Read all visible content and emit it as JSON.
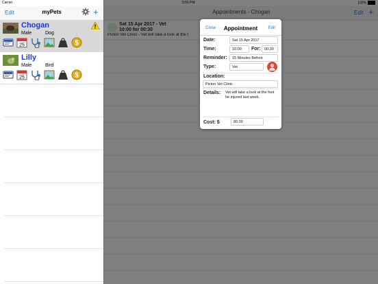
{
  "status": {
    "carrier": "Carrier",
    "time": "5:55 PM",
    "battery": "100%"
  },
  "master": {
    "edit": "Edit",
    "title": "myPets",
    "pets": [
      {
        "name": "Chogan",
        "sex": "Male",
        "species": "Dog",
        "date_badge": "25"
      },
      {
        "name": "Lilly",
        "sex": "Male",
        "species": "Bird",
        "date_badge": "25"
      }
    ]
  },
  "detail": {
    "title": "Appointments - Chogan",
    "edit": "Edit",
    "appointment": {
      "line1": "Sat 15 Apr 2017 - Vet",
      "line2": "10:00 for 00:30",
      "line3": "Picton Vet Clinic - Vet will take a look at the f"
    }
  },
  "popover": {
    "close": "Close",
    "title": "Appointment",
    "edit": "Edit",
    "date_label": "Date:",
    "date_value": "Sat 15 Apr 2017",
    "time_label": "Time:",
    "time_value": "10:00",
    "for_label": "For:",
    "for_value": "00:30",
    "reminder_label": "Reminder:",
    "reminder_value": "15 Minutes Before",
    "type_label": "Type:",
    "type_value": "Vet",
    "location_label": "Location:",
    "location_value": "Picton Vet Clinic",
    "details_label": "Details:",
    "details_value": "Vet will take a look at the foot he injured last week.",
    "cost_label": "Cost: $",
    "cost_value": "80.00"
  }
}
